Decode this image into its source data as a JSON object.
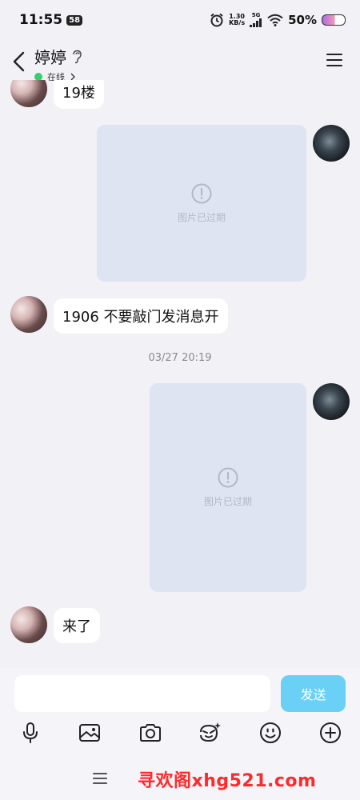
{
  "status_bar": {
    "time": "11:55",
    "badge": "58",
    "net_speed_value": "1.30",
    "net_speed_unit": "KB/s",
    "signal_label": "5G",
    "battery_percent": "50%"
  },
  "header": {
    "contact_name": "婷婷",
    "online_status": "在线"
  },
  "messages": {
    "m1_text": "19楼",
    "img1_text": "图片已过期",
    "m2_text": "1906 不要敲门发消息开",
    "timestamp": "03/27 20:19",
    "img2_text": "图片已过期",
    "m3_text": "来了"
  },
  "input": {
    "value": "",
    "send_label": "发送"
  },
  "toolbar": {
    "icons": [
      "microphone-icon",
      "photo-icon",
      "camera-icon",
      "sticker-icon",
      "emoji-icon",
      "plus-icon"
    ]
  },
  "watermark": "寻欢阁xhg521.com",
  "colors": {
    "background": "#f1f1f6",
    "bubble": "#ffffff",
    "send_button": "#6ad0f6",
    "online_dot": "#2fd36a",
    "expired_card": "#dfe4f3",
    "watermark": "#ff2a2a"
  }
}
